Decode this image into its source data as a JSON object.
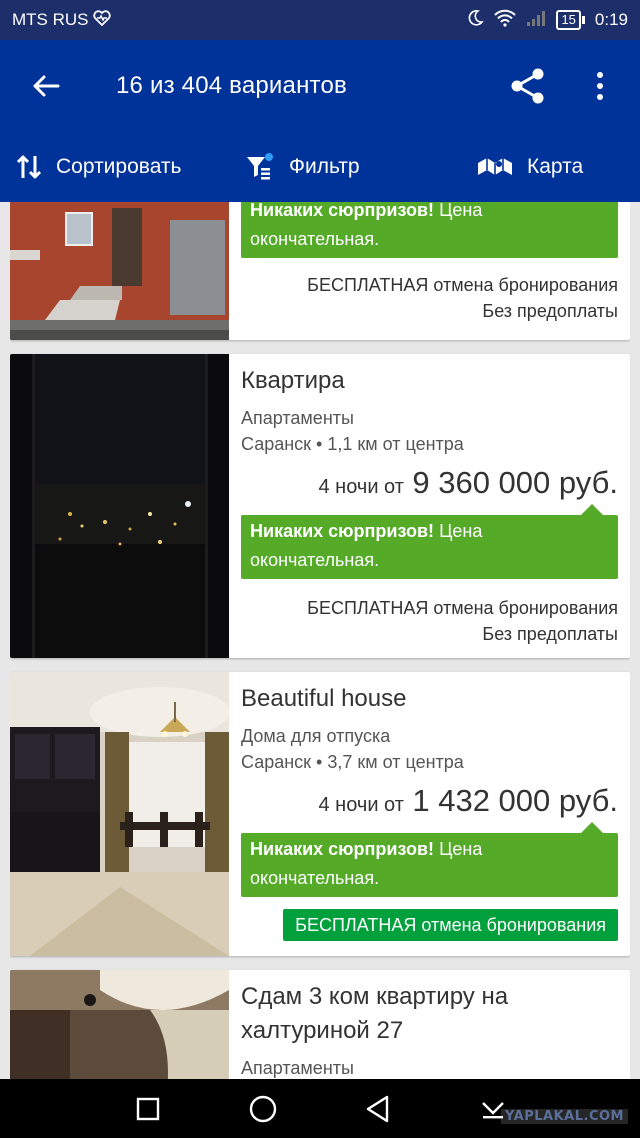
{
  "status_bar": {
    "carrier": "MTS RUS",
    "battery": "15",
    "time": "0:19"
  },
  "toolbar": {
    "title": "16 из 404 вариантов"
  },
  "tabs": [
    {
      "label": "Сортировать",
      "icon": "sort-icon"
    },
    {
      "label": "Фильтр",
      "icon": "filter-icon"
    },
    {
      "label": "Карта",
      "icon": "map-icon"
    }
  ],
  "cards": [
    {
      "green_bold": "Никаких сюрпризов!",
      "green_rest": "Цена",
      "green_line2": "окончательная.",
      "cancel": "БЕСПЛАТНАЯ отмена бронирования",
      "prepay": "Без предоплаты"
    },
    {
      "title": "Квартира",
      "type": "Апартаменты",
      "location": "Саранск • 1,1 км от центра",
      "nights": "4 ночи от",
      "price": "9 360 000 руб.",
      "green_bold": "Никаких сюрпризов!",
      "green_rest": "Цена",
      "green_line2": "окончательная.",
      "cancel": "БЕСПЛАТНАЯ отмена бронирования",
      "prepay": "Без предоплаты"
    },
    {
      "title": "Beautiful house",
      "type": "Дома для отпуска",
      "location": "Саранск • 3,7 км от центра",
      "nights": "4 ночи от",
      "price": "1 432 000 руб.",
      "green_bold": "Никаких сюрпризов!",
      "green_rest": "Цена",
      "green_line2": "окончательная.",
      "cancel": "БЕСПЛАТНАЯ отмена бронирования"
    },
    {
      "title_line1": "Сдам 3 ком квартиру на",
      "title_line2": "халтуриной 27",
      "type": "Апартаменты"
    }
  ],
  "watermark": "YAPLAKAL.COM",
  "colors": {
    "status_bar": "#1c2f6b",
    "app_bar": "#003399",
    "green_box": "#55aa28",
    "free_badge": "#00a03c"
  }
}
